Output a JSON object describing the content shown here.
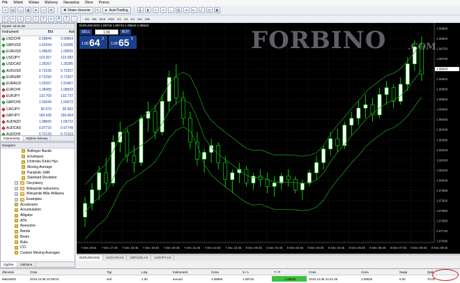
{
  "menu": [
    "Plik",
    "Widok",
    "Wstaw",
    "Wykresy",
    "Narzędzia",
    "Okno",
    "Pomoc"
  ],
  "toolbar": {
    "new_order": "Nowe zlecenie",
    "autotrading": "AutoTrading"
  },
  "timeframes": [
    "M1",
    "M5",
    "M15",
    "M30",
    "H1",
    "H4",
    "D1",
    "W1",
    "MN"
  ],
  "market_watch": {
    "title": "Rynek: 10:41:48",
    "headers": [
      "Instrument",
      "Bid",
      "Ask"
    ],
    "rows": [
      {
        "symbol": "USDCHF",
        "bid": "0.99844",
        "ask": "0.99864",
        "dir": "up"
      },
      {
        "symbol": "GBPUSD",
        "bid": "1.50264",
        "ask": "1.50285",
        "dir": "up"
      },
      {
        "symbol": "EURUSD",
        "bid": "1.08643",
        "ask": "1.08655",
        "dir": "up"
      },
      {
        "symbol": "USDJPY",
        "bid": "123.067",
        "ask": "123.082",
        "dir": "up"
      },
      {
        "symbol": "USDCAD",
        "bid": "1.35267",
        "ask": "1.35285",
        "dir": "up"
      },
      {
        "symbol": "AUDUSD",
        "bid": "0.72236",
        "ask": "0.72257",
        "dir": "up"
      },
      {
        "symbol": "EURGBP",
        "bid": "0.72290",
        "ask": "0.72307",
        "dir": "up"
      },
      {
        "symbol": "EURAUD",
        "bid": "1.50357",
        "ask": "1.50407",
        "dir": "up"
      },
      {
        "symbol": "EURCHF",
        "bid": "1.08483",
        "ask": "1.08503",
        "dir": "dn"
      },
      {
        "symbol": "EURJPY",
        "bid": "133.709",
        "ask": "133.727",
        "dir": "dn"
      },
      {
        "symbol": "GBPCHF",
        "bid": "1.50040",
        "ask": "1.50072",
        "dir": "up"
      },
      {
        "symbol": "CADJPY",
        "bid": "90.970",
        "ask": "90.992",
        "dir": "dn"
      },
      {
        "symbol": "GBPJPY",
        "bid": "184.936",
        "ask": "184.964",
        "dir": "dn"
      },
      {
        "symbol": "AUDNZD",
        "bid": "1.08665",
        "ask": "1.08710",
        "dir": "dn"
      },
      {
        "symbol": "AUDCAD",
        "bid": "0.97715",
        "ask": "0.97749",
        "dir": "dn"
      },
      {
        "symbol": "AUDCHF",
        "bid": "0.72120",
        "ask": "0.72163",
        "dir": "up"
      }
    ],
    "tabs": [
      "Instrumenty",
      "Wykres tickowy"
    ]
  },
  "navigator": {
    "title": "Navigator",
    "items": [
      {
        "label": "Bollinger Bands",
        "level": 2,
        "kind": "ind"
      },
      {
        "label": "Envelopes",
        "level": 2,
        "kind": "ind"
      },
      {
        "label": "Ichimoku Kinko Hyo",
        "level": 2,
        "kind": "ind"
      },
      {
        "label": "Moving Average",
        "level": 2,
        "kind": "ind"
      },
      {
        "label": "Parabolic SAR",
        "level": 2,
        "kind": "ind"
      },
      {
        "label": "Standard Deviation",
        "level": 2,
        "kind": "ind"
      },
      {
        "label": "Oscylatory",
        "level": 1,
        "kind": "fold"
      },
      {
        "label": "Wskaźniki wolumenu",
        "level": 1,
        "kind": "fold"
      },
      {
        "label": "Wskaźniki Billa Williama",
        "level": 1,
        "kind": "fold"
      },
      {
        "label": "Examples",
        "level": 1,
        "kind": "fold"
      },
      {
        "label": "Accelerator",
        "level": 1,
        "kind": "ind"
      },
      {
        "label": "Accumulation",
        "level": 1,
        "kind": "ind"
      },
      {
        "label": "Alligator",
        "level": 1,
        "kind": "ind"
      },
      {
        "label": "ATR",
        "level": 1,
        "kind": "ind"
      },
      {
        "label": "Awesome",
        "level": 1,
        "kind": "ind"
      },
      {
        "label": "Bands",
        "level": 1,
        "kind": "ind"
      },
      {
        "label": "Bears",
        "level": 1,
        "kind": "ind"
      },
      {
        "label": "Bulls",
        "level": 1,
        "kind": "ind"
      },
      {
        "label": "CCI",
        "level": 1,
        "kind": "ind"
      },
      {
        "label": "Custom Moving Averages",
        "level": 1,
        "kind": "ind"
      }
    ],
    "tabs": [
      "Ogólne",
      "Ulubione"
    ]
  },
  "chart": {
    "title": "EURUSD,M15  1.08718 1.08743 1.08642 1.08643",
    "trade_panel": {
      "sell": "SELL",
      "buy": "BUY",
      "lot": "1.00",
      "sell_big": "64",
      "sell_small": "3",
      "sell_prefix": "1.08",
      "buy_big": "65",
      "buy_small": "5",
      "buy_prefix": "1.08"
    },
    "logo": "FORBINO",
    "logo_domain": ".COM",
    "price_labels": [
      "1.08880",
      "1.08820",
      "1.08760",
      "1.08700",
      "1.08643",
      "1.08620",
      "1.08580",
      "1.08520",
      "1.08460",
      "1.08400",
      "1.08340",
      "1.08280",
      "1.08220",
      "1.08160",
      "1.08100",
      "1.08040",
      "1.07980",
      "1.07920",
      "1.07860",
      "1.07800",
      "1.07740",
      "1.07680"
    ],
    "time_labels": [
      "7 Dec 2015",
      "7 Dec 17:45",
      "7 Dec 18:45",
      "7 Dec 19:45",
      "7 Dec 20:45",
      "7 Dec 21:45",
      "7 Dec 22:45",
      "7 Dec 23:45",
      "8 Dec 00:45",
      "8 Dec 01:45",
      "8 Dec 02:45",
      "8 Dec 03:45",
      "8 Dec 04:45",
      "8 Dec 05:45",
      "8 Dec 06:45",
      "8 Dec 07:45",
      "8 Dec 08:45",
      "8 Dec 09:45"
    ],
    "tabs": [
      "EURUSD,M15",
      "USDCHF,H4",
      "GBPUSD,H4",
      "USDJPY,H4"
    ]
  },
  "chart_data": {
    "type": "candlestick",
    "ylim": [
      1.0765,
      1.0894
    ],
    "candles": [
      [
        1.078,
        1.0792,
        1.0774,
        1.0788
      ],
      [
        1.0788,
        1.08,
        1.0784,
        1.0796
      ],
      [
        1.0796,
        1.081,
        1.079,
        1.0806
      ],
      [
        1.0806,
        1.0815,
        1.0796,
        1.08
      ],
      [
        1.08,
        1.0828,
        1.0798,
        1.0824
      ],
      [
        1.0824,
        1.0836,
        1.0818,
        1.083
      ],
      [
        1.083,
        1.0832,
        1.0812,
        1.0816
      ],
      [
        1.0816,
        1.0822,
        1.0806,
        1.0812
      ],
      [
        1.0812,
        1.084,
        1.081,
        1.0838
      ],
      [
        1.0838,
        1.0848,
        1.083,
        1.0842
      ],
      [
        1.0842,
        1.0846,
        1.0826,
        1.083
      ],
      [
        1.083,
        1.0852,
        1.0828,
        1.0848
      ],
      [
        1.0848,
        1.0866,
        1.0842,
        1.0862
      ],
      [
        1.0862,
        1.087,
        1.0846,
        1.085
      ],
      [
        1.085,
        1.0854,
        1.0834,
        1.0838
      ],
      [
        1.0838,
        1.0842,
        1.082,
        1.0824
      ],
      [
        1.0824,
        1.083,
        1.081,
        1.0814
      ],
      [
        1.0814,
        1.082,
        1.0806,
        1.0818
      ],
      [
        1.0818,
        1.0826,
        1.0812,
        1.0822
      ],
      [
        1.0822,
        1.0824,
        1.0808,
        1.0812
      ],
      [
        1.0812,
        1.0816,
        1.0798,
        1.0802
      ],
      [
        1.0802,
        1.0808,
        1.0794,
        1.0806
      ],
      [
        1.0806,
        1.0812,
        1.08,
        1.0808
      ],
      [
        1.0808,
        1.081,
        1.0798,
        1.08
      ],
      [
        1.08,
        1.0806,
        1.0796,
        1.0804
      ],
      [
        1.0804,
        1.0808,
        1.0798,
        1.0802
      ],
      [
        1.0802,
        1.0806,
        1.0794,
        1.0798
      ],
      [
        1.0798,
        1.0804,
        1.0792,
        1.08
      ],
      [
        1.08,
        1.0806,
        1.0796,
        1.0804
      ],
      [
        1.0804,
        1.0808,
        1.0798,
        1.0802
      ],
      [
        1.0802,
        1.0804,
        1.0794,
        1.0796
      ],
      [
        1.0796,
        1.0802,
        1.079,
        1.08
      ],
      [
        1.08,
        1.0808,
        1.0798,
        1.0806
      ],
      [
        1.0806,
        1.0816,
        1.0802,
        1.0812
      ],
      [
        1.0812,
        1.0822,
        1.0808,
        1.082
      ],
      [
        1.082,
        1.083,
        1.0816,
        1.0826
      ],
      [
        1.0826,
        1.0832,
        1.0818,
        1.0822
      ],
      [
        1.0822,
        1.0836,
        1.082,
        1.0834
      ],
      [
        1.0834,
        1.0842,
        1.0828,
        1.0838
      ],
      [
        1.0838,
        1.0848,
        1.0834,
        1.0844
      ],
      [
        1.0844,
        1.0852,
        1.0838,
        1.0846
      ],
      [
        1.0846,
        1.085,
        1.0836,
        1.084
      ],
      [
        1.084,
        1.0856,
        1.0838,
        1.0852
      ],
      [
        1.0852,
        1.086,
        1.0846,
        1.0856
      ],
      [
        1.0856,
        1.0858,
        1.0844,
        1.0848
      ],
      [
        1.0848,
        1.0862,
        1.0846,
        1.0858
      ],
      [
        1.0858,
        1.0874,
        1.0854,
        1.087
      ],
      [
        1.087,
        1.0884,
        1.0866,
        1.088
      ],
      [
        1.088,
        1.0886,
        1.086,
        1.0864
      ]
    ]
  },
  "terminal": {
    "headers": [
      "Zlecenie",
      "Czas",
      "Typ",
      "Loty",
      "Instrument",
      "Cena",
      "S / L",
      "T / P",
      "Czas",
      "Cena",
      "Swap",
      "Zysk"
    ],
    "row": [
      "86616932",
      "2015.12.08 10:39:04",
      "sell",
      "1.00",
      "eurusd",
      "1.08690",
      "1.08742",
      "1.08620",
      "2015.12.08 10:41:26",
      "1.08620",
      "0.00",
      "70.00"
    ]
  },
  "colors": {
    "bull": "#000000",
    "bear": "#ffffff",
    "wick": "#00ff00",
    "band": "#1a9a1a",
    "bg": "#000000"
  }
}
